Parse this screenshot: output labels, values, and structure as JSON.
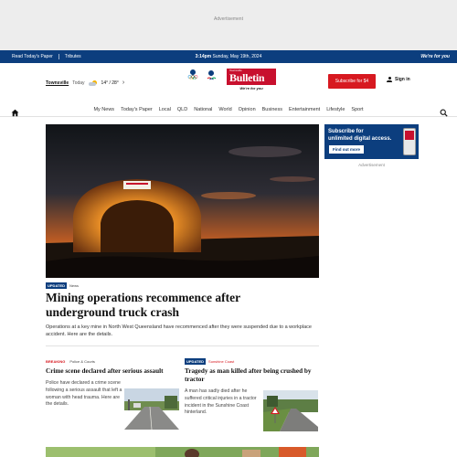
{
  "ad_top": {
    "label": "Advertisement"
  },
  "topbar": {
    "link_1": "Read Today's Paper",
    "link_2": "Tributes",
    "time": "3:14pm",
    "date": "Sunday, May 19th, 2024",
    "tagline": "We're for you"
  },
  "masthead": {
    "town": "Townsville",
    "today_label": "Today",
    "temps": "14° / 28°",
    "weather_icon": "partly-cloudy-icon",
    "logo_small": "Townsville",
    "logo_big": "Bulletin",
    "logo_tag": "We're for you",
    "subscribe_label": "Subscribe for $4",
    "signin_label": "Sign in"
  },
  "nav": {
    "items": [
      "My News",
      "Today's Paper",
      "Local",
      "QLD",
      "National",
      "World",
      "Opinion",
      "Business",
      "Entertainment",
      "Lifestyle",
      "Sport"
    ]
  },
  "hero": {
    "badge": "Updated",
    "category": "News",
    "title": "Mining operations recommence after underground truck crash",
    "description": "Operations at a key mine in North West Queensland have recommenced after they were suspended due to a workplace accident. Here are the details."
  },
  "cards": [
    {
      "badge": "Breaking",
      "category": "Police & Courts",
      "title": "Crime scene declared after serious assault",
      "body": "Police have declared a crime scene following a serious assault that left a woman with head trauma. Here are the details."
    },
    {
      "badge": "Updated",
      "category": "Sunshine Coast",
      "title": "Tragedy as man killed after being crushed by tractor",
      "body": "A man has sadly died after he suffered critical injuries in a tractor incident in the Sunshine Coast hinterland."
    }
  ],
  "side_ad": {
    "headline_1": "Subscribe for",
    "headline_2": "unlimited digital access.",
    "button": "Find out more",
    "label": "Advertisement"
  },
  "colors": {
    "brand_blue": "#0c3e7e",
    "brand_red": "#d71920"
  }
}
